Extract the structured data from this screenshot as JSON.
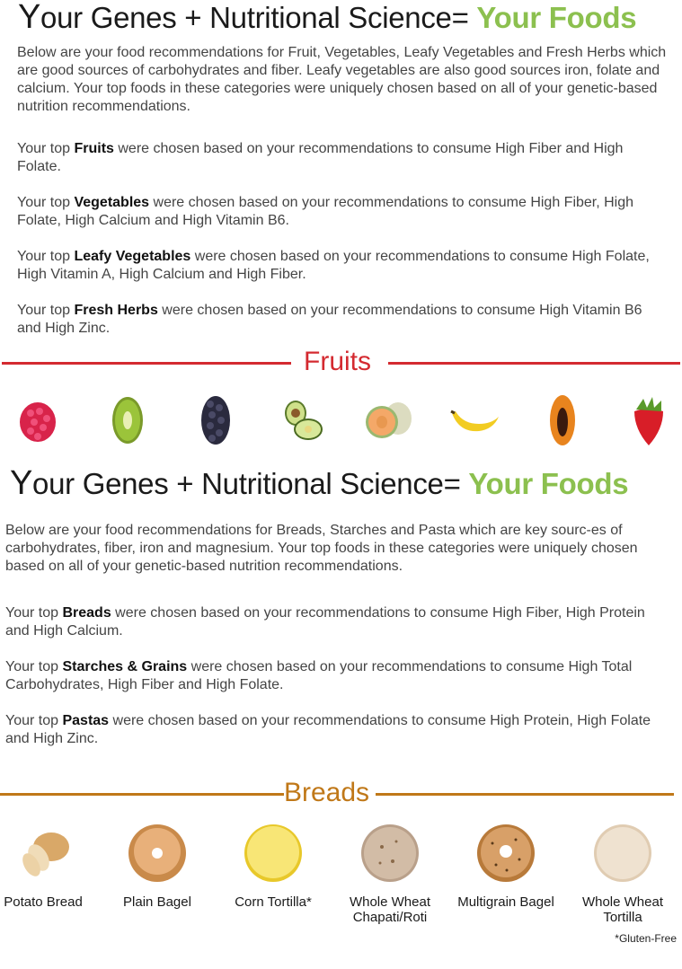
{
  "section1": {
    "title_prefix": "Y",
    "title_main": "our Genes + Nutritional Science= ",
    "title_accent": "Your Foods",
    "intro": "Below are your food recommendations for Fruit, Vegetables, Leafy Vegetables and Fresh Herbs which are good sources of carbohydrates and fiber. Leafy vegetables are also good sources iron, folate and calcium. Your top foods in these categories were uniquely chosen based on all of your genetic-based nutrition recommendations.",
    "items": [
      {
        "pre": "Your top ",
        "bold": "Fruits",
        "post": " were chosen based on your recommendations to consume High Fiber and High Folate."
      },
      {
        "pre": "Your top ",
        "bold": "Vegetables",
        "post": " were chosen based on your recommendations to consume High Fiber, High Folate, High Calcium and High Vitamin B6."
      },
      {
        "pre": "Your top ",
        "bold": "Leafy Vegetables",
        "post": " were chosen based on your recommendations to consume High Folate, High Vitamin A, High Calcium and High Fiber."
      },
      {
        "pre": "Your top ",
        "bold": "Fresh Herbs",
        "post": "  were chosen based on your recommendations to consume High Vitamin B6 and High Zinc."
      }
    ]
  },
  "fruits_section": {
    "label": "Fruits",
    "color": "#d42a30",
    "items": [
      "raspberry",
      "kiwi",
      "blackberry",
      "avocado",
      "cantaloupe",
      "banana",
      "papaya",
      "strawberry"
    ]
  },
  "section2": {
    "title_prefix": "Y",
    "title_main": "our Genes + Nutritional Science= ",
    "title_accent": "Your Foods",
    "intro": "Below are your food recommendations for Breads, Starches and Pasta which are key sourc-es of carbohydrates, fiber, iron and magnesium. Your top foods in these categories were uniquely chosen based on all of your genetic-based nutrition recommendations.",
    "items": [
      {
        "pre": "Your top ",
        "bold": "Breads",
        "post": "  were chosen based on your recommendations to consume High Fiber, High Protein and High Calcium."
      },
      {
        "pre": "Your top ",
        "bold": "Starches & Grains",
        "post": "  were chosen based on your recommendations to consume High Total Carbohydrates, High Fiber and High Folate."
      },
      {
        "pre": "Your top ",
        "bold": "Pastas",
        "post": "  were chosen based on your recommendations to consume High Protein, High Folate and High Zinc."
      }
    ]
  },
  "breads_section": {
    "label": "Breads",
    "color": "#c07818",
    "items": [
      {
        "name": "Potato Bread"
      },
      {
        "name": "Plain Bagel"
      },
      {
        "name": "Corn Tortilla*"
      },
      {
        "name": "Whole Wheat Chapati/Roti"
      },
      {
        "name": "Multigrain Bagel"
      },
      {
        "name": "Whole Wheat Tortilla"
      }
    ],
    "footnote": "*Gluten-Free"
  },
  "colors": {
    "accent_green": "#8cc04f",
    "fruits_red": "#d42a30",
    "breads_brown": "#c07818"
  }
}
